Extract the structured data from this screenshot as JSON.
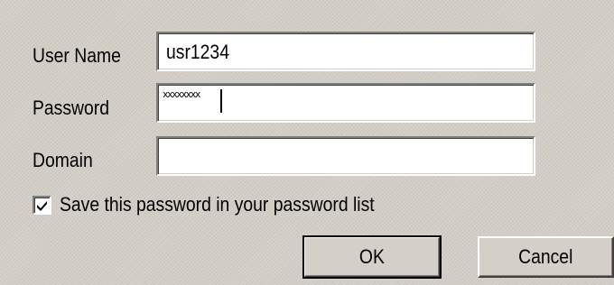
{
  "dialog": {
    "username_label": "User Name",
    "username_value": "usr1234",
    "password_label": "Password",
    "password_mask": "xxxxxxxx",
    "domain_label": "Domain",
    "domain_value": "",
    "save_password_checked": true,
    "save_password_label": "Save this password in your password list",
    "ok_label": "OK",
    "cancel_label": "Cancel"
  },
  "icons": {
    "checkbox_mark": "check-mark-icon"
  },
  "colors": {
    "dialog_background": "#d4d0c8",
    "field_background": "#ffffff"
  }
}
